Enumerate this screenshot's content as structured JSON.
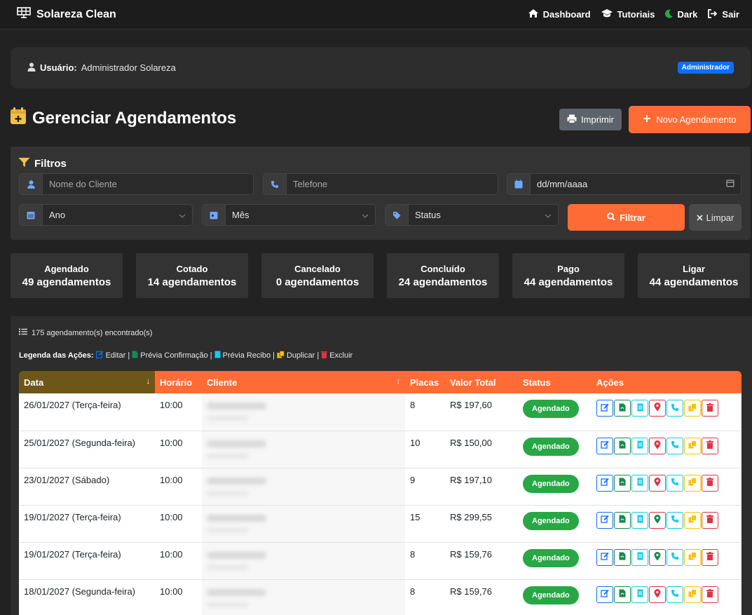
{
  "navbar": {
    "brand": "Solareza Clean",
    "links": [
      {
        "label": "Dashboard",
        "icon": "home-icon"
      },
      {
        "label": "Tutoriais",
        "icon": "graduation-cap-icon"
      },
      {
        "label": "Dark",
        "icon": "moon-icon"
      },
      {
        "label": "Sair",
        "icon": "sign-out-icon"
      }
    ]
  },
  "user": {
    "label": "Usuário:",
    "name": "Administrador Solareza",
    "role_badge": "Administrador"
  },
  "page": {
    "title": "Gerenciar Agendamentos",
    "print_label": "Imprimir",
    "new_label": "Novo Agendamento"
  },
  "filters": {
    "title": "Filtros",
    "client_placeholder": "Nome do Cliente",
    "phone_placeholder": "Telefone",
    "date_placeholder": "dd/mm/aaaa",
    "year_value": "Ano",
    "month_value": "Mês",
    "status_value": "Status",
    "filter_label": "Filtrar",
    "clear_label": "Limpar"
  },
  "stats": [
    {
      "label": "Agendado",
      "value": "49 agendamentos"
    },
    {
      "label": "Cotado",
      "value": "14 agendamentos"
    },
    {
      "label": "Cancelado",
      "value": "0 agendamentos"
    },
    {
      "label": "Concluído",
      "value": "24 agendamentos"
    },
    {
      "label": "Pago",
      "value": "44 agendamentos"
    },
    {
      "label": "Ligar",
      "value": "44 agendamentos"
    }
  ],
  "results": {
    "count_text": "175 agendamento(s) encontrado(s)",
    "legend_title": "Legenda das Ações:",
    "legend_items": [
      "Editar",
      "Prévia Confirmação",
      "Prévia Recibo",
      "Duplicar",
      "Excluir"
    ]
  },
  "table": {
    "headers": {
      "date": "Data",
      "time": "Horário",
      "client": "Cliente",
      "plates": "Placas",
      "total": "Valor Total",
      "status": "Status",
      "actions": "Ações"
    },
    "sort_down": "↓",
    "sort_both": "↕",
    "rows": [
      {
        "date": "26/01/2027 (Terça-feira)",
        "time": "10:00",
        "plates": "8",
        "total": "R$ 197,60",
        "status": "Agendado",
        "map_color": "#dc3545"
      },
      {
        "date": "25/01/2027 (Segunda-feira)",
        "time": "10:00",
        "plates": "10",
        "total": "R$ 150,00",
        "status": "Agendado",
        "map_color": "#dc3545"
      },
      {
        "date": "23/01/2027 (Sábado)",
        "time": "10:00",
        "plates": "9",
        "total": "R$ 197,10",
        "status": "Agendado",
        "map_color": "#dc3545"
      },
      {
        "date": "19/01/2027 (Terça-feira)",
        "time": "10:00",
        "plates": "15",
        "total": "R$ 299,55",
        "status": "Agendado",
        "map_color": "#198754"
      },
      {
        "date": "19/01/2027 (Terça-feira)",
        "time": "10:00",
        "plates": "8",
        "total": "R$ 159,76",
        "status": "Agendado",
        "map_color": "#198754"
      },
      {
        "date": "18/01/2027 (Segunda-feira)",
        "time": "10:00",
        "plates": "8",
        "total": "R$ 159,76",
        "status": "Agendado",
        "map_color": "#dc3545"
      }
    ]
  },
  "colors": {
    "accent": "#ff6b35",
    "success": "#28a745",
    "badge": "#0d6efd"
  }
}
